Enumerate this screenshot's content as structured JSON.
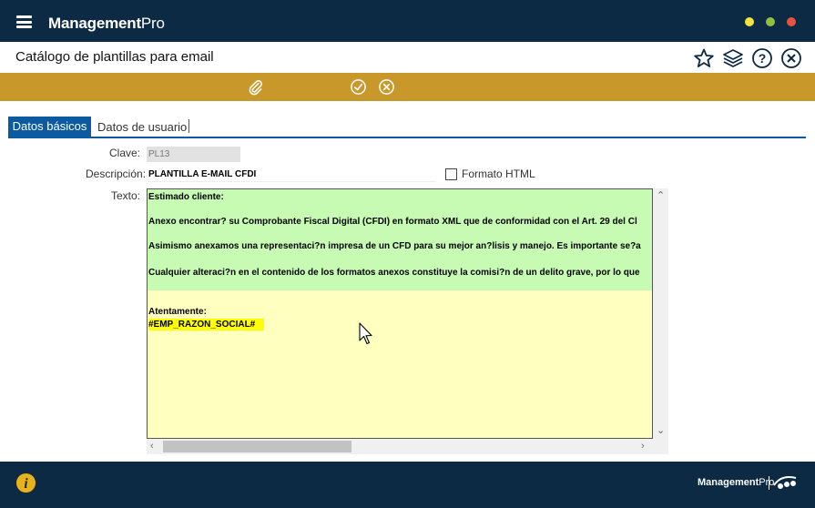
{
  "app": {
    "brand_bold": "Management",
    "brand_light": "Pro",
    "window_buttons": [
      {
        "name": "minimize",
        "color": "#f3e33a"
      },
      {
        "name": "maximize",
        "color": "#8fc13f"
      },
      {
        "name": "close",
        "color": "#e8523f"
      }
    ]
  },
  "header": {
    "title": "Catálogo de plantillas para email",
    "icons": [
      "star-icon",
      "layers-icon",
      "help-icon",
      "close-icon"
    ]
  },
  "toolbar": {
    "icons": [
      "attach-icon",
      "accept-icon",
      "cancel-icon"
    ]
  },
  "tabs": [
    {
      "label": "Datos básicos",
      "active": true
    },
    {
      "label": "Datos de usuario",
      "active": false
    }
  ],
  "form": {
    "clave_label": "Clave:",
    "clave_value": "PL13",
    "descripcion_label": "Descripción:",
    "descripcion_value": "PLANTILLA E-MAIL CFDI",
    "formato_html_label": "Formato HTML",
    "formato_html_checked": false,
    "texto_label": "Texto:"
  },
  "editor": {
    "lines": [
      "Estimado cliente:",
      "Anexo encontrar? su Comprobante Fiscal Digital (CFDI) en formato XML que de conformidad con el Art. 29 del Cl",
      "Asimismo anexamos una representaci?n impresa de un CFD para su mejor an?lisis y manejo. Es importante se?a",
      "Cualquier alteraci?n en el contenido de los formatos anexos constituye la comisi?n de un delito grave, por lo que",
      "Atentamente:",
      "#EMP_RAZON_SOCIAL#"
    ],
    "green_bg": "#c7fbb4",
    "yellow_bg": "#ffffc0",
    "highlight": "#ffff00"
  },
  "footer": {
    "brand_bold": "Management",
    "brand_light": "Pro"
  },
  "colors": {
    "titlebar": "#0c2a44",
    "toolbar": "#c9982a",
    "tab_active": "#0c5aa0",
    "info_icon": "#e8b21a"
  }
}
